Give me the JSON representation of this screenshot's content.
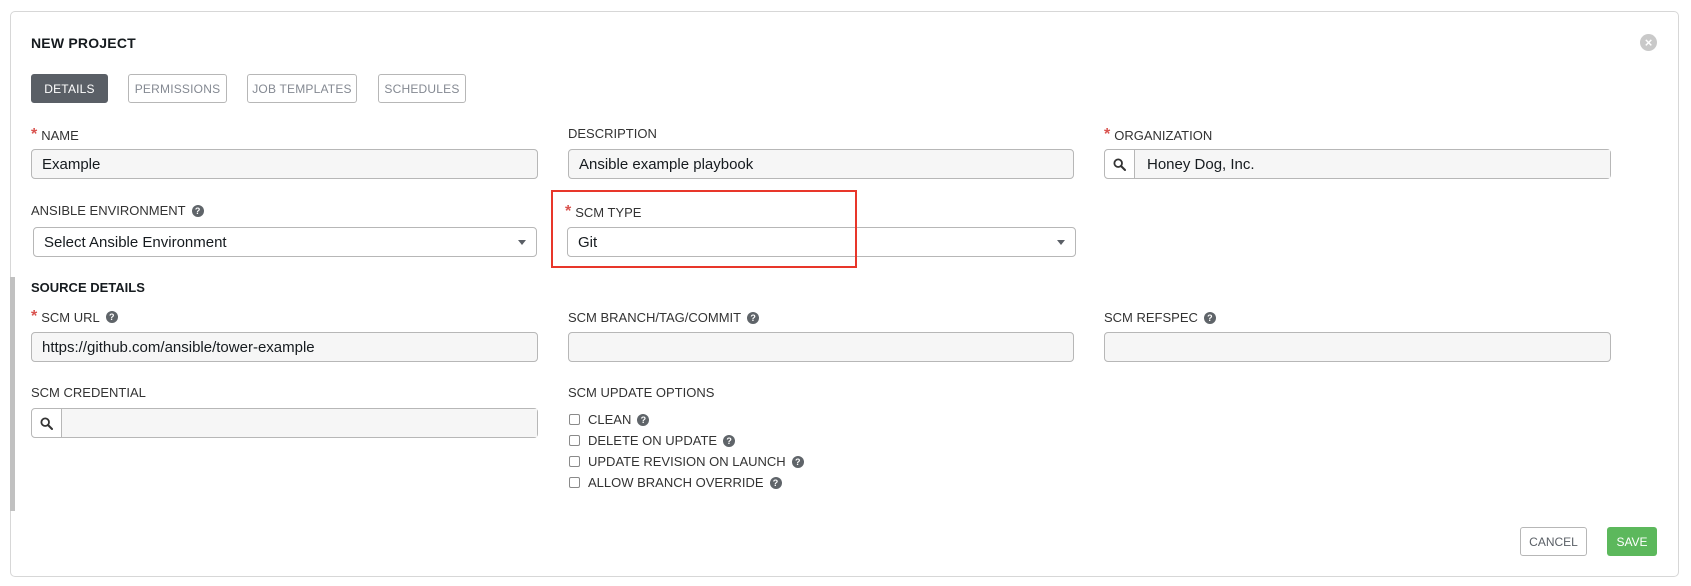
{
  "dialog": {
    "title": "NEW PROJECT",
    "close_glyph": "×",
    "close_icon": "close-circle-icon"
  },
  "tabs": [
    {
      "label": "DETAILS",
      "active": true
    },
    {
      "label": "PERMISSIONS",
      "active": false
    },
    {
      "label": "JOB TEMPLATES",
      "active": false
    },
    {
      "label": "SCHEDULES",
      "active": false
    }
  ],
  "fields": {
    "name": {
      "label": "NAME",
      "required": true,
      "value": "Example"
    },
    "description": {
      "label": "DESCRIPTION",
      "required": false,
      "value": "Ansible example playbook"
    },
    "organization": {
      "label": "ORGANIZATION",
      "required": true,
      "value": "Honey Dog, Inc."
    },
    "ansible_environment": {
      "label": "ANSIBLE ENVIRONMENT",
      "value": "Select Ansible Environment"
    },
    "scm_type": {
      "label": "SCM TYPE",
      "required": true,
      "value": "Git"
    }
  },
  "source_details": {
    "title": "SOURCE DETAILS",
    "scm_url": {
      "label": "SCM URL",
      "required": true,
      "value": "https://github.com/ansible/tower-example"
    },
    "scm_branch": {
      "label": "SCM BRANCH/TAG/COMMIT",
      "value": ""
    },
    "scm_refspec": {
      "label": "SCM REFSPEC",
      "value": ""
    },
    "scm_credential": {
      "label": "SCM CREDENTIAL",
      "value": ""
    },
    "scm_update_options": {
      "label": "SCM UPDATE OPTIONS",
      "options": [
        {
          "label": "CLEAN",
          "checked": false
        },
        {
          "label": "DELETE ON UPDATE",
          "checked": false
        },
        {
          "label": "UPDATE REVISION ON LAUNCH",
          "checked": false
        },
        {
          "label": "ALLOW BRANCH OVERRIDE",
          "checked": false
        }
      ]
    }
  },
  "required_marker": "*",
  "help_glyph": "?",
  "actions": {
    "cancel": "CANCEL",
    "save": "SAVE"
  },
  "colors": {
    "save": "#5cb85c",
    "active_tab": "#5a5f66",
    "required": "#d9534f",
    "highlight": "#e8362a"
  }
}
